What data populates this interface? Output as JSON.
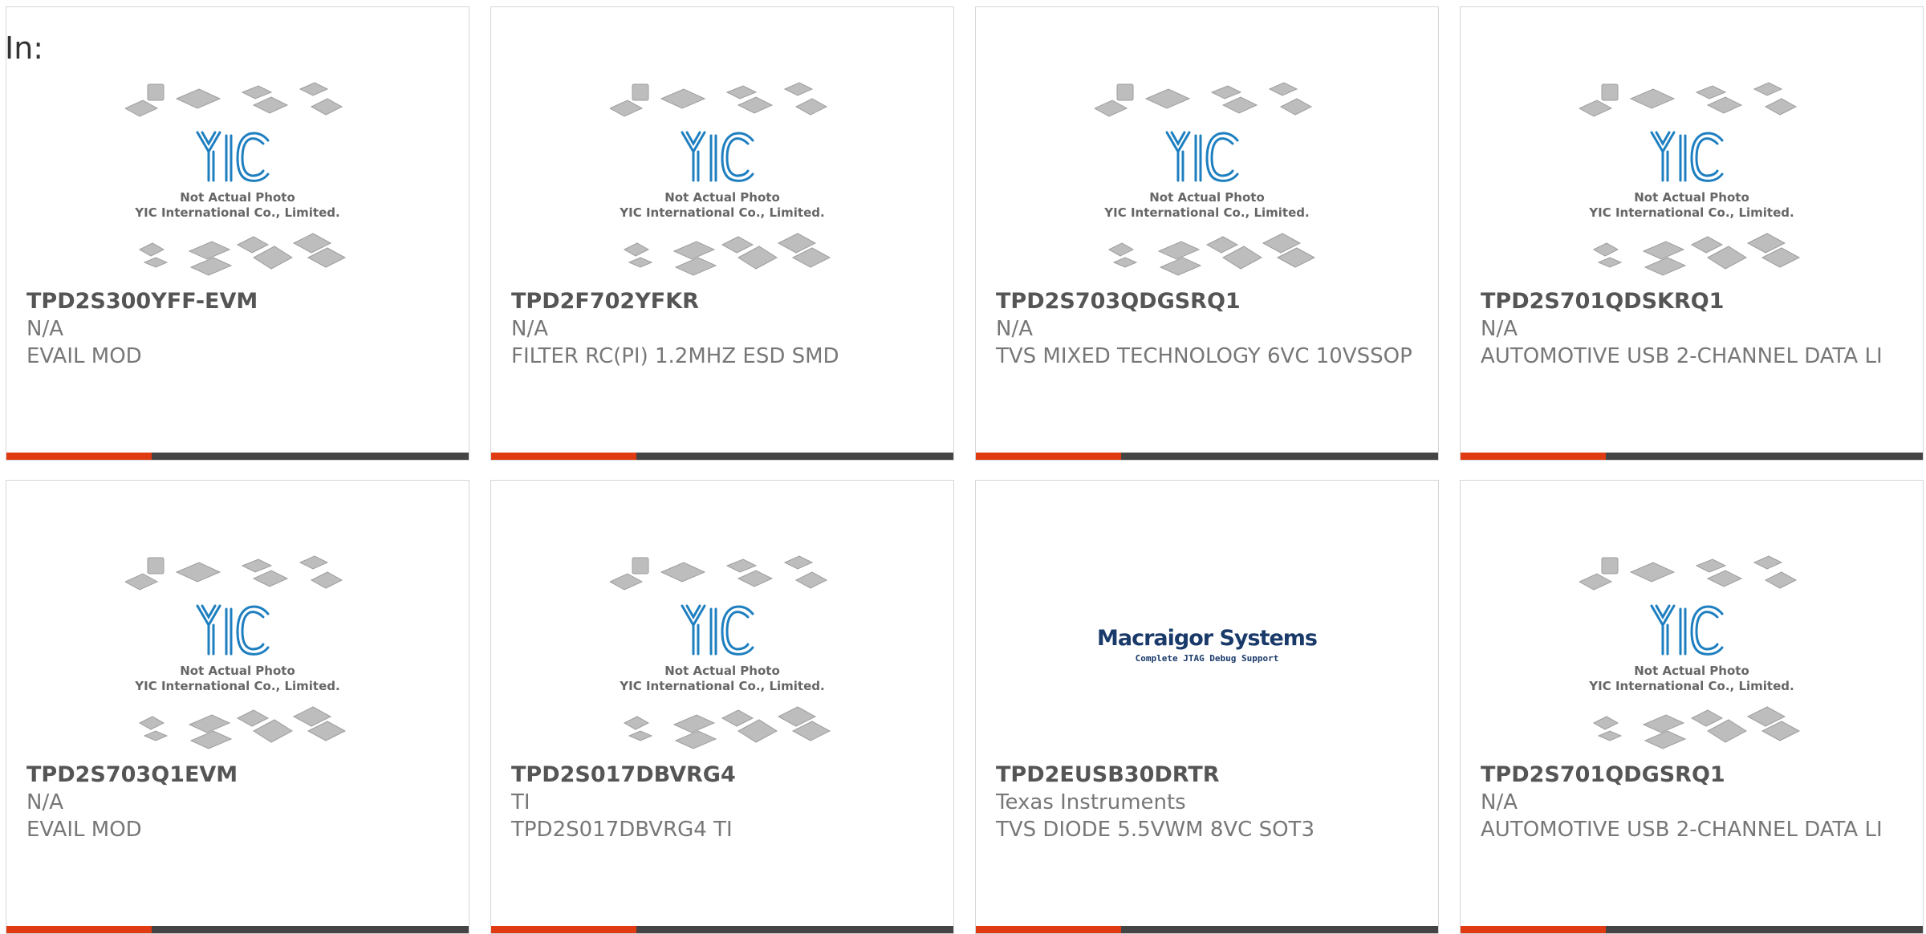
{
  "header": {
    "label": "In:"
  },
  "placeholder_image": {
    "caption_line1": "Not Actual Photo",
    "caption_line2": "YIC International Co., Limited.",
    "logo_text": "YIC"
  },
  "brand_image": {
    "title": "Macraigor Systems",
    "subtitle": "Complete JTAG Debug Support"
  },
  "colors": {
    "accent": "#e03a12",
    "bar": "#444444",
    "logo_blue": "#1e7fc0"
  },
  "products": [
    {
      "part": "TPD2S300YFF-EVM",
      "mfr": "N/A",
      "desc": "EVAIL MOD",
      "image": "yic"
    },
    {
      "part": "TPD2F702YFKR",
      "mfr": "N/A",
      "desc": "FILTER RC(PI) 1.2MHZ ESD SMD",
      "image": "yic"
    },
    {
      "part": "TPD2S703QDGSRQ1",
      "mfr": "N/A",
      "desc": "TVS MIXED TECHNOLOGY 6VC 10VSSOP",
      "image": "yic"
    },
    {
      "part": "TPD2S701QDSKRQ1",
      "mfr": "N/A",
      "desc": "AUTOMOTIVE USB 2-CHANNEL DATA LI",
      "image": "yic"
    },
    {
      "part": "TPD2S703Q1EVM",
      "mfr": "N/A",
      "desc": "EVAIL MOD",
      "image": "yic"
    },
    {
      "part": "TPD2S017DBVRG4",
      "mfr": "TI",
      "desc": "TPD2S017DBVRG4 TI",
      "image": "yic"
    },
    {
      "part": "TPD2EUSB30DRTR",
      "mfr": "Texas Instruments",
      "desc": "TVS DIODE 5.5VWM 8VC SOT3",
      "image": "macraigor"
    },
    {
      "part": "TPD2S701QDGSRQ1",
      "mfr": "N/A",
      "desc": "AUTOMOTIVE USB 2-CHANNEL DATA LI",
      "image": "yic"
    }
  ]
}
